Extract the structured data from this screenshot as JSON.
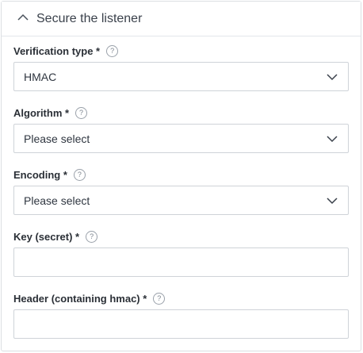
{
  "section": {
    "title": "Secure the listener",
    "toggle_icon": "chevron-up-icon"
  },
  "help_glyph": "?",
  "fields": {
    "verification_type": {
      "label": "Verification type *",
      "value": "HMAC"
    },
    "algorithm": {
      "label": "Algorithm *",
      "value": "Please select"
    },
    "encoding": {
      "label": "Encoding *",
      "value": "Please select"
    },
    "key": {
      "label": "Key (secret) *",
      "value": ""
    },
    "header": {
      "label": "Header (containing hmac) *",
      "value": ""
    }
  }
}
